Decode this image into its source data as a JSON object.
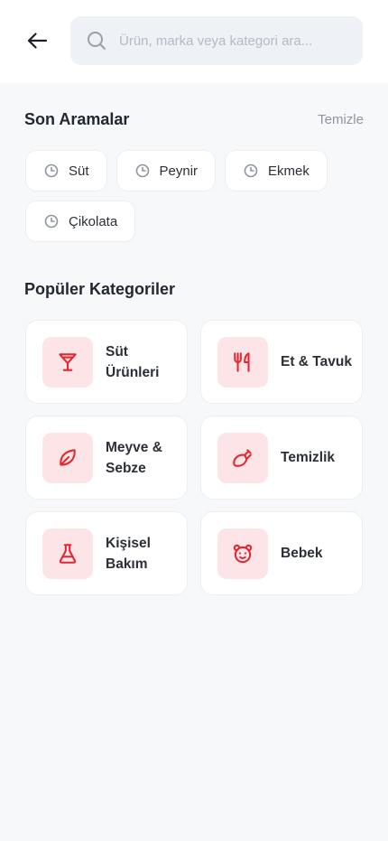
{
  "search": {
    "placeholder": "Ürün, marka veya kategori ara..."
  },
  "recent": {
    "title": "Son Aramalar",
    "clear_label": "Temizle",
    "items": [
      {
        "label": "Süt",
        "icon": "clock-icon"
      },
      {
        "label": "Peynir",
        "icon": "clock-icon"
      },
      {
        "label": "Ekmek",
        "icon": "clock-icon"
      },
      {
        "label": "Çikolata",
        "icon": "clock-icon"
      }
    ]
  },
  "categories": {
    "title": "Popüler Kategoriler",
    "items": [
      {
        "label": "Süt Ürünleri",
        "icon": "glass-icon"
      },
      {
        "label": "Et & Tavuk",
        "icon": "fork-knife-icon"
      },
      {
        "label": "Meyve & Sebze",
        "icon": "leaf-icon"
      },
      {
        "label": "Temizlik",
        "icon": "spray-icon"
      },
      {
        "label": "Kişisel Bakım",
        "icon": "flask-icon"
      },
      {
        "label": "Bebek",
        "icon": "baby-bear-icon"
      }
    ]
  },
  "colors": {
    "accent": "#e5252f",
    "accent_bg": "#fde4e6",
    "page_bg": "#f7f8fa",
    "search_bg": "#eef1f6"
  }
}
